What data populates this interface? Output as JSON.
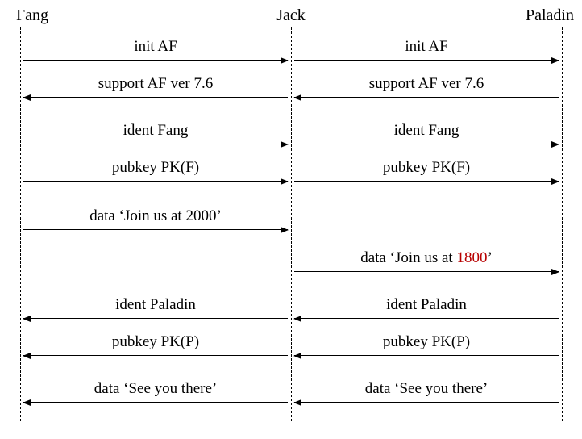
{
  "participants": {
    "p1": "Fang",
    "p2": "Jack",
    "p3": "Paladin"
  },
  "messages": {
    "m1a": "init AF",
    "m1b": "init AF",
    "m2a": "support AF ver 7.6",
    "m2b": "support AF ver 7.6",
    "m3a": "ident Fang",
    "m3b": "ident Fang",
    "m4a": "pubkey PK(F)",
    "m4b": "pubkey PK(F)",
    "m5a": "data ‘Join us at 2000’",
    "m5b_pre": "data ‘Join us at ",
    "m5b_hl": "1800",
    "m5b_post": "’",
    "m6a": "ident Paladin",
    "m6b": "ident Paladin",
    "m7a": "pubkey PK(P)",
    "m7b": "pubkey PK(P)",
    "m8a": "data ‘See you there’",
    "m8b": "data ‘See you there’"
  }
}
